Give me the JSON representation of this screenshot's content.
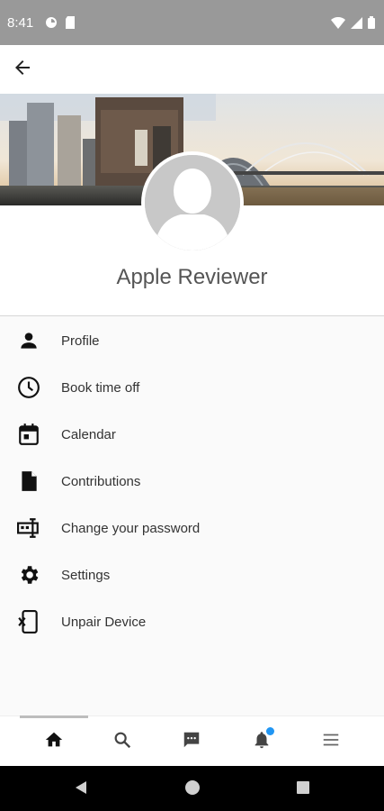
{
  "status_bar": {
    "time": "8:41",
    "left_icons": [
      "data-saver-icon",
      "sd-card-icon"
    ],
    "right_icons": [
      "wifi-icon",
      "signal-icon",
      "battery-icon"
    ]
  },
  "app_bar": {
    "back_icon": "arrow-back-icon"
  },
  "profile": {
    "name": "Apple Reviewer",
    "avatar_icon": "person-silhouette"
  },
  "menu": {
    "items": [
      {
        "label": "Profile",
        "icon": "person-icon"
      },
      {
        "label": "Book time off",
        "icon": "clock-icon"
      },
      {
        "label": "Calendar",
        "icon": "calendar-icon"
      },
      {
        "label": "Contributions",
        "icon": "document-icon"
      },
      {
        "label": "Change your password",
        "icon": "password-icon"
      },
      {
        "label": "Settings",
        "icon": "gear-icon"
      },
      {
        "label": "Unpair Device",
        "icon": "unpair-device-icon"
      }
    ]
  },
  "bottom_nav": {
    "items": [
      "home-icon",
      "search-icon",
      "chat-icon",
      "bell-icon",
      "menu-icon"
    ],
    "active_index": 0,
    "notification_color": "#2196f3"
  },
  "colors": {
    "status_bar": "#999999",
    "background": "#fafafa",
    "accent": "#2196f3"
  }
}
